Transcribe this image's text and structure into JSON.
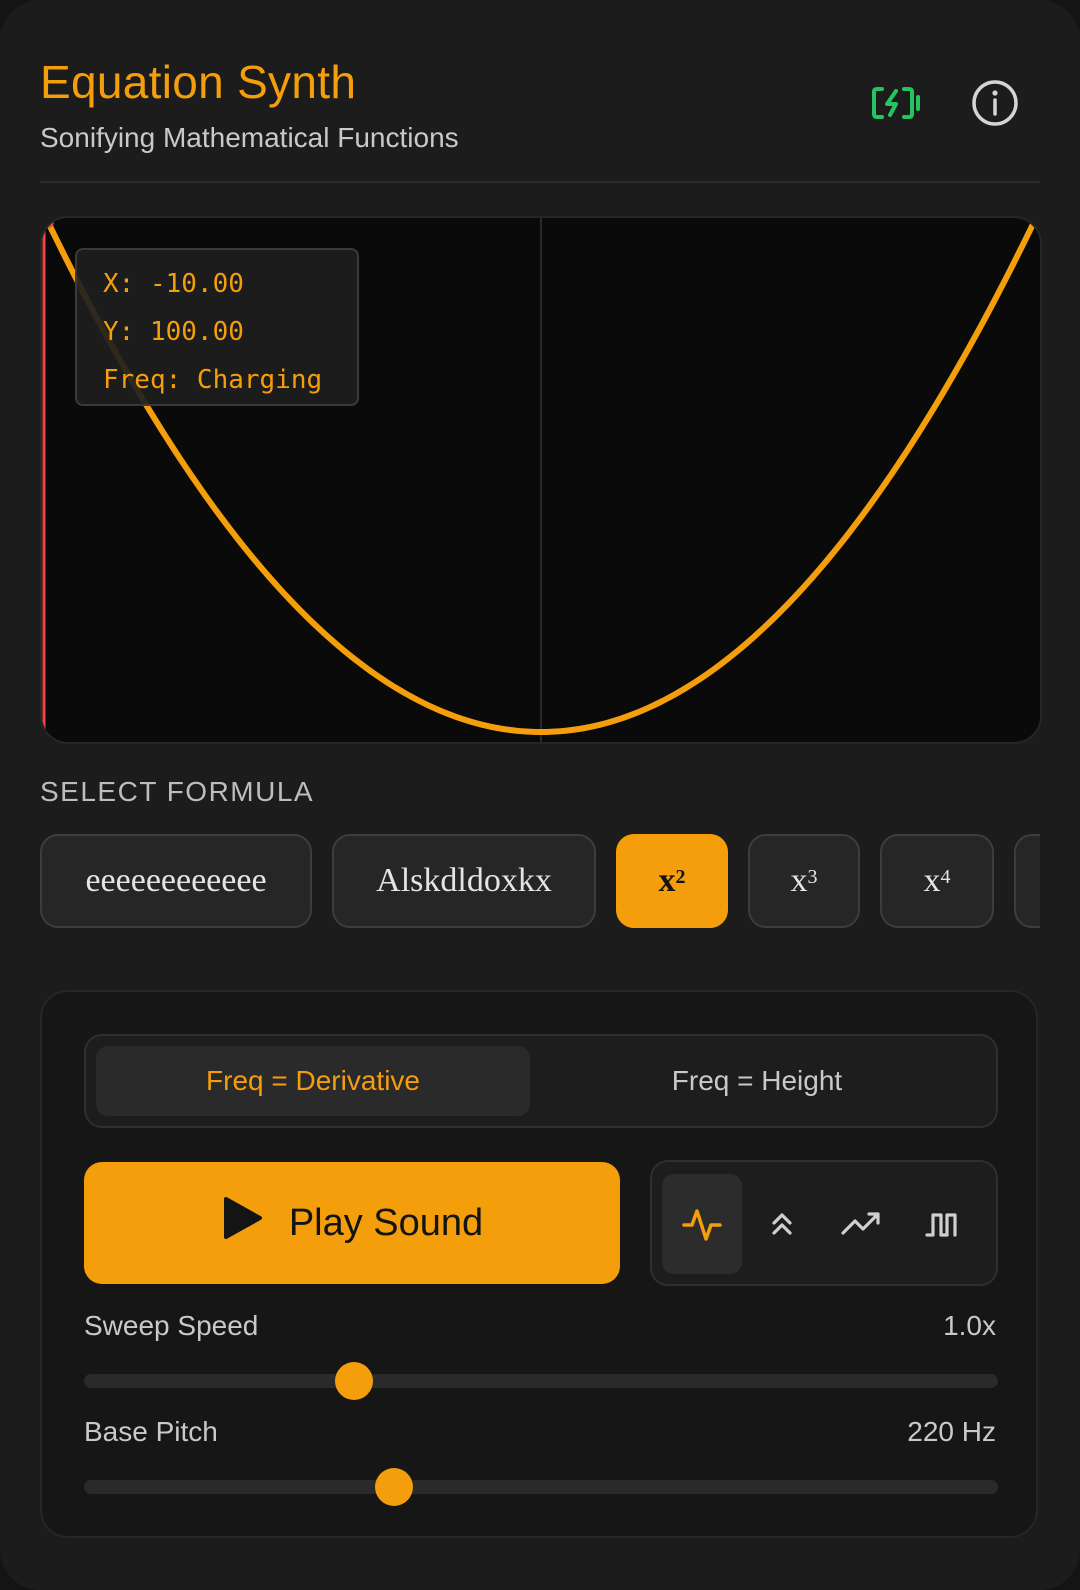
{
  "header": {
    "title": "Equation Synth",
    "subtitle": "Sonifying Mathematical Functions",
    "battery_icon": "battery-charging-icon",
    "info_icon": "info-icon"
  },
  "plot": {
    "readout": {
      "x_line": "X: -10.00",
      "y_line": "Y: 100.00",
      "freq_line": "Freq: Charging"
    }
  },
  "chart_data": {
    "type": "line",
    "function": "x^2",
    "x": [
      -10,
      -9,
      -8,
      -7,
      -6,
      -5,
      -4,
      -3,
      -2,
      -1,
      0,
      1,
      2,
      3,
      4,
      5,
      6,
      7,
      8,
      9,
      10
    ],
    "y": [
      100,
      81,
      64,
      49,
      36,
      25,
      16,
      9,
      4,
      1,
      0,
      1,
      4,
      9,
      16,
      25,
      36,
      49,
      64,
      81,
      100
    ],
    "xlim": [
      -10,
      10
    ],
    "ylim": [
      0,
      100
    ],
    "cursor_x": -10,
    "color": "#f59e0b"
  },
  "formulas": {
    "label": "SELECT FORMULA",
    "items": [
      {
        "label": "eeeeeeeeeeee",
        "base": "",
        "exp": ""
      },
      {
        "label": "Alskdldoxkx",
        "base": "",
        "exp": ""
      },
      {
        "label": "",
        "base": "x",
        "exp": "2"
      },
      {
        "label": "",
        "base": "x",
        "exp": "3"
      },
      {
        "label": "",
        "base": "x",
        "exp": "4"
      }
    ],
    "active_index": 2
  },
  "controls": {
    "mode_options": [
      "Freq = Derivative",
      "Freq = Height"
    ],
    "active_mode": 0,
    "play_label": "Play Sound",
    "waveforms": [
      "sine-wave-icon",
      "chevrons-up-icon",
      "trending-up-icon",
      "square-wave-icon"
    ],
    "active_waveform": 0,
    "sweep_speed": {
      "label": "Sweep Speed",
      "value_text": "1.0x",
      "fraction": 0.295
    },
    "base_pitch": {
      "label": "Base Pitch",
      "value_text": "220 Hz",
      "fraction": 0.339
    }
  },
  "colors": {
    "accent": "#f59e0b",
    "battery": "#22c55e",
    "background": "#1c1c1c"
  }
}
